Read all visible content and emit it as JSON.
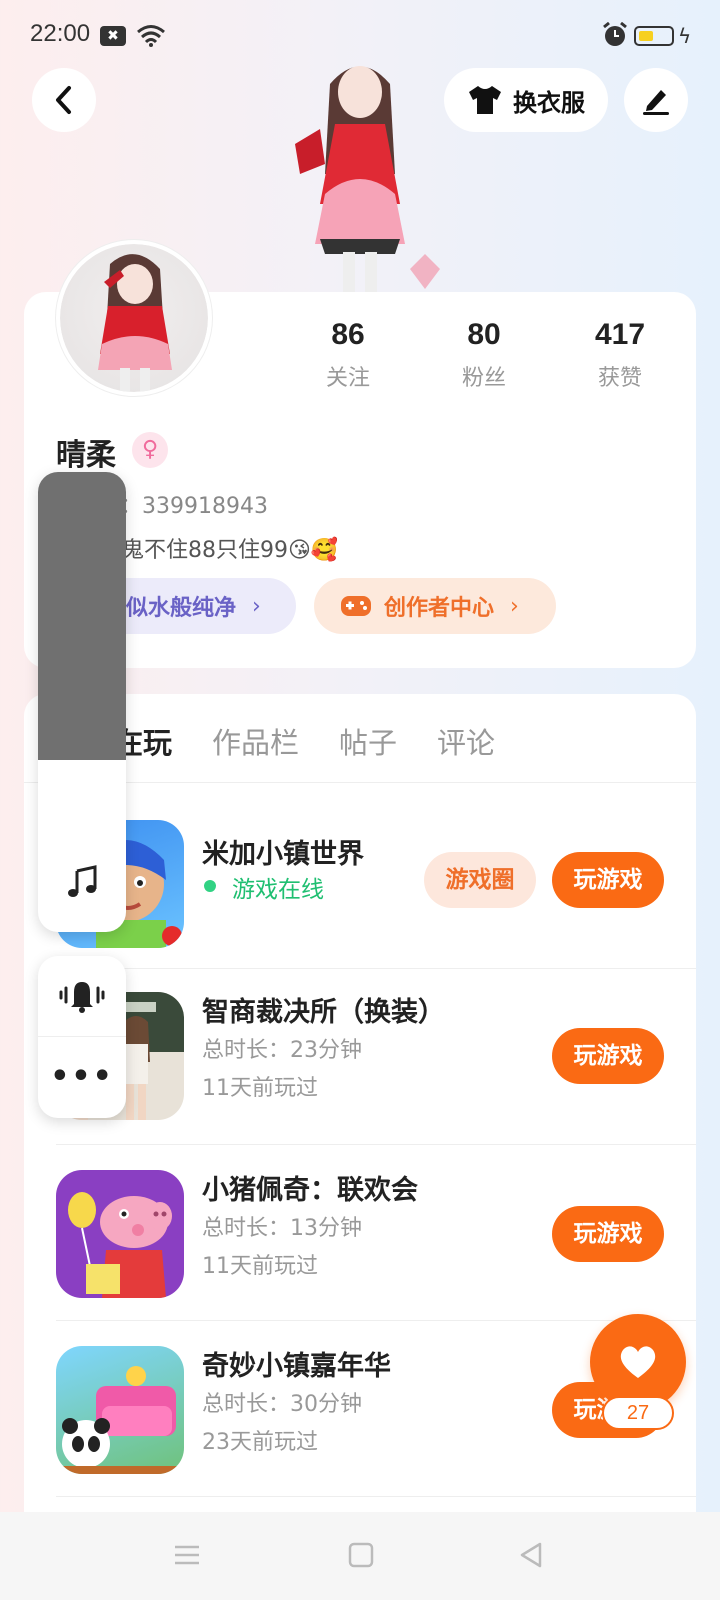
{
  "status": {
    "time": "22:00",
    "x_badge": "✖"
  },
  "header": {
    "dress_label": "换衣服"
  },
  "stats": [
    {
      "num": "86",
      "label": "关注"
    },
    {
      "num": "80",
      "label": "粉丝"
    },
    {
      "num": "417",
      "label": "获赞"
    }
  ],
  "profile": {
    "name": "晴柔",
    "gender_icon": "♀",
    "id_line": "233号：339918943",
    "bio": "本人有鬼不住88只住99😘🥰"
  },
  "pills": {
    "pure": "似水般纯净",
    "creator": "创作者中心",
    "chevron": "›"
  },
  "tabs": [
    "最近在玩",
    "作品栏",
    "帖子",
    "评论"
  ],
  "games": [
    {
      "title": "米加小镇世界",
      "status": "游戏在线",
      "circle_label": "游戏圈",
      "play_label": "玩游戏"
    },
    {
      "title": "智商裁决所（换装）",
      "duration": "总时长：23分钟",
      "last": "11天前玩过",
      "play_label": "玩游戏"
    },
    {
      "title": "小猪佩奇：联欢会",
      "duration": "总时长：13分钟",
      "last": "11天前玩过",
      "play_label": "玩游戏"
    },
    {
      "title": "奇妙小镇嘉年华",
      "duration": "总时长：30分钟",
      "last": "23天前玩过",
      "play_label": "玩游戏"
    }
  ],
  "float": {
    "more": "•••"
  },
  "like": {
    "count": "27"
  },
  "colors": {
    "accent": "#fa6a14",
    "online": "#1fbf71",
    "pure": "#6a62c6"
  }
}
